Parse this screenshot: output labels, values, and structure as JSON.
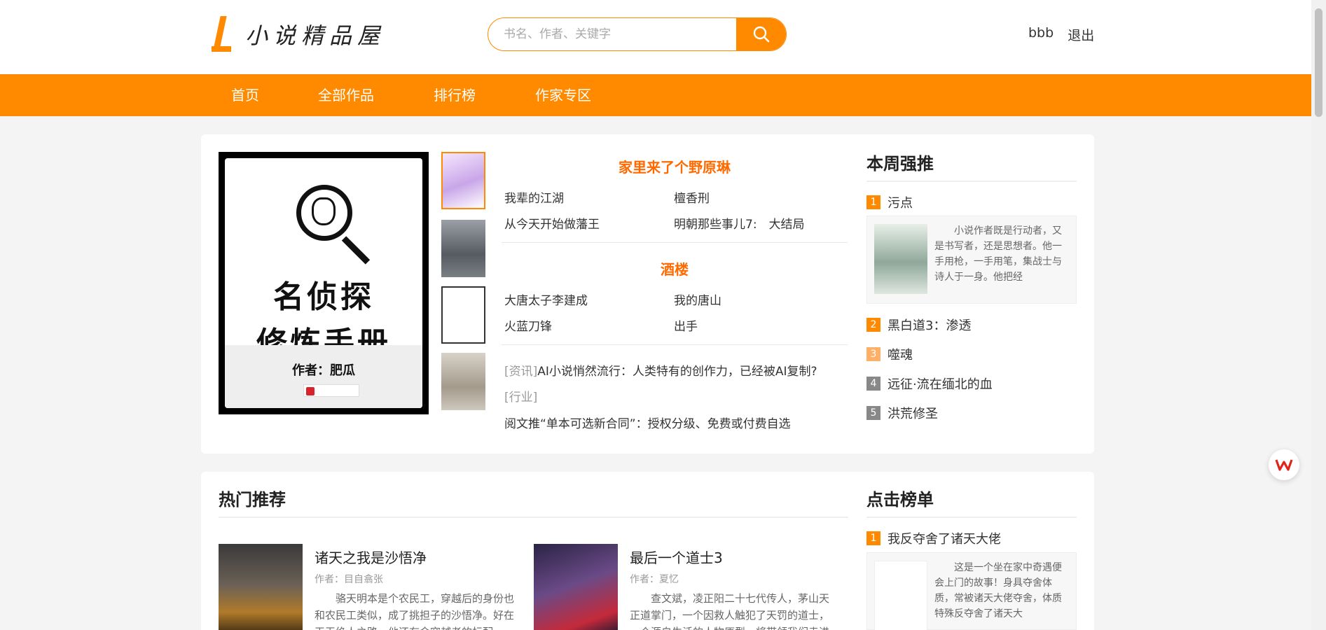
{
  "brand": {
    "name": "小说精品屋",
    "accent": "#ff8a00"
  },
  "search": {
    "placeholder": "书名、作者、关键字"
  },
  "user": {
    "name": "bbb",
    "logout": "退出"
  },
  "nav": [
    "首页",
    "全部作品",
    "排行榜",
    "作家专区"
  ],
  "featured": {
    "cover": {
      "title_line1": "名侦探",
      "title_line2": "修炼手册",
      "author": "作者：肥瓜"
    },
    "section1": {
      "title": "家里来了个野原琳",
      "links": [
        "我辈的江湖",
        "檀香刑",
        "从今天开始做藩王",
        "明朝那些事儿7:　大结局"
      ]
    },
    "section2": {
      "title": "酒楼",
      "links": [
        "大唐太子李建成",
        "我的唐山",
        "火蓝刀锋",
        "出手"
      ]
    },
    "news": [
      {
        "tag": "[资讯]",
        "text": "AI小说悄然流行：人类特有的创作力，已经被AI复制?"
      },
      {
        "tag": "[行业]",
        "text": ""
      },
      {
        "tag": "",
        "text": "阅文推“单本可选新合同”：授权分级、免费或付费自选"
      }
    ]
  },
  "weekly": {
    "title": "本周强推",
    "first": {
      "rank": "1",
      "name": "污点",
      "desc": "小说作者既是行动者，又是书写者，还是思想者。他一手用枪，一手用笔，集战士与诗人于一身。他把经"
    },
    "others": [
      {
        "rank": "2",
        "name": "黑白道3：渗透"
      },
      {
        "rank": "3",
        "name": "噬魂"
      },
      {
        "rank": "4",
        "name": "远征·流在缅北的血"
      },
      {
        "rank": "5",
        "name": "洪荒修圣"
      }
    ]
  },
  "hot": {
    "title": "热门推荐",
    "books": [
      {
        "name": "诸天之我是沙悟净",
        "author": "作者：目自翕张",
        "desc": "骆天明本是个农民工，穿越后的身份也和农民工类似，成了挑担子的沙悟净。好在天无绝人之路，他还有金穿越者的标配"
      },
      {
        "name": "最后一个道士3",
        "author": "作者：夏忆",
        "desc": "查文斌，凌正阳二十七代传人，茅山天正道掌门，一个因救人触犯了天罚的道士，一个源自生活的人物原型，将带领我们走进"
      }
    ]
  },
  "clicks": {
    "title": "点击榜单",
    "first": {
      "rank": "1",
      "name": "我反夺舍了诸天大佬",
      "desc": "这是一个坐在家中奇遇便会上门的故事！身具夺舍体质，常被诸天大佬夺舍，体质特殊反夺舍了诸天大"
    }
  }
}
